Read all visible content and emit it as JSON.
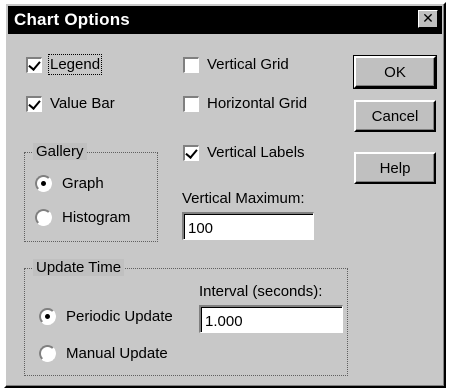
{
  "window": {
    "title": "Chart Options",
    "close_glyph": "✕"
  },
  "options": {
    "legend": {
      "label": "Legend",
      "checked": true
    },
    "value_bar": {
      "label": "Value Bar",
      "checked": true
    },
    "vertical_grid": {
      "label": "Vertical Grid",
      "checked": false
    },
    "horizontal_grid": {
      "label": "Horizontal Grid",
      "checked": false
    },
    "vertical_labels": {
      "label": "Vertical Labels",
      "checked": true
    }
  },
  "gallery": {
    "label": "Gallery",
    "graph": {
      "label": "Graph",
      "selected": true
    },
    "histogram": {
      "label": "Histogram",
      "selected": false
    }
  },
  "vertical_maximum": {
    "label": "Vertical Maximum:",
    "value": "100"
  },
  "update_time": {
    "label": "Update Time",
    "periodic": {
      "label": "Periodic Update",
      "selected": true
    },
    "manual": {
      "label": "Manual Update",
      "selected": false
    },
    "interval_label": "Interval (seconds):",
    "interval_value": "1.000"
  },
  "buttons": {
    "ok": "OK",
    "cancel": "Cancel",
    "help": "Help"
  },
  "icons": {
    "close": "close-icon",
    "checkbox_checked": "checkmark-icon",
    "radio_selected": "radio-dot-icon"
  },
  "colors": {
    "titlebar_bg": "#000000",
    "titlebar_text": "#ffffff",
    "window_bg": "#c0c0c0"
  }
}
